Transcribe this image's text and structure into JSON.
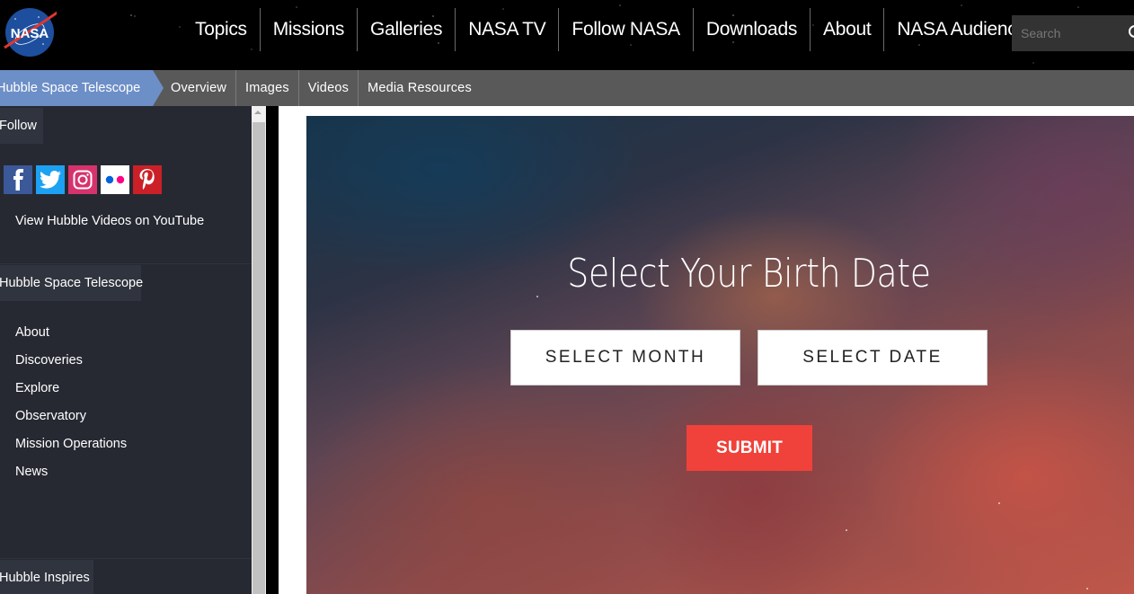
{
  "header": {
    "logo_text": "NASA",
    "nav": [
      "Topics",
      "Missions",
      "Galleries",
      "NASA TV",
      "Follow NASA",
      "Downloads",
      "About",
      "NASA Audiences"
    ],
    "search": {
      "placeholder": "Search",
      "value": ""
    }
  },
  "subnav": {
    "section": "Hubble Space Telescope",
    "items": [
      "Overview",
      "Images",
      "Videos",
      "Media Resources"
    ]
  },
  "sidebar": {
    "follow_label": "Follow",
    "social": [
      {
        "name": "Facebook",
        "icon": "facebook-icon",
        "color": "#3b5998"
      },
      {
        "name": "Twitter",
        "icon": "twitter-icon",
        "color": "#1da1f2"
      },
      {
        "name": "Instagram",
        "icon": "instagram-icon",
        "color": "#d6336c"
      },
      {
        "name": "Flickr",
        "icon": "flickr-icon",
        "color": "#ffffff"
      },
      {
        "name": "Pinterest",
        "icon": "pinterest-icon",
        "color": "#cb2027"
      }
    ],
    "youtube_link": "View Hubble Videos on YouTube",
    "hst_label": "Hubble Space Telescope",
    "hst_items": [
      "About",
      "Discoveries",
      "Explore",
      "Observatory",
      "Mission Operations",
      "News"
    ],
    "inspires_label": "Hubble Inspires"
  },
  "hero": {
    "title": "Select Your Birth Date",
    "month_select": "SELECT MONTH",
    "date_select": "SELECT DATE",
    "submit": "SUBMIT",
    "submit_color": "#f0413a"
  },
  "colors": {
    "section_tab": "#6d8fc7",
    "subnav_bg": "#595959",
    "sidebar_bg": "#262932"
  }
}
